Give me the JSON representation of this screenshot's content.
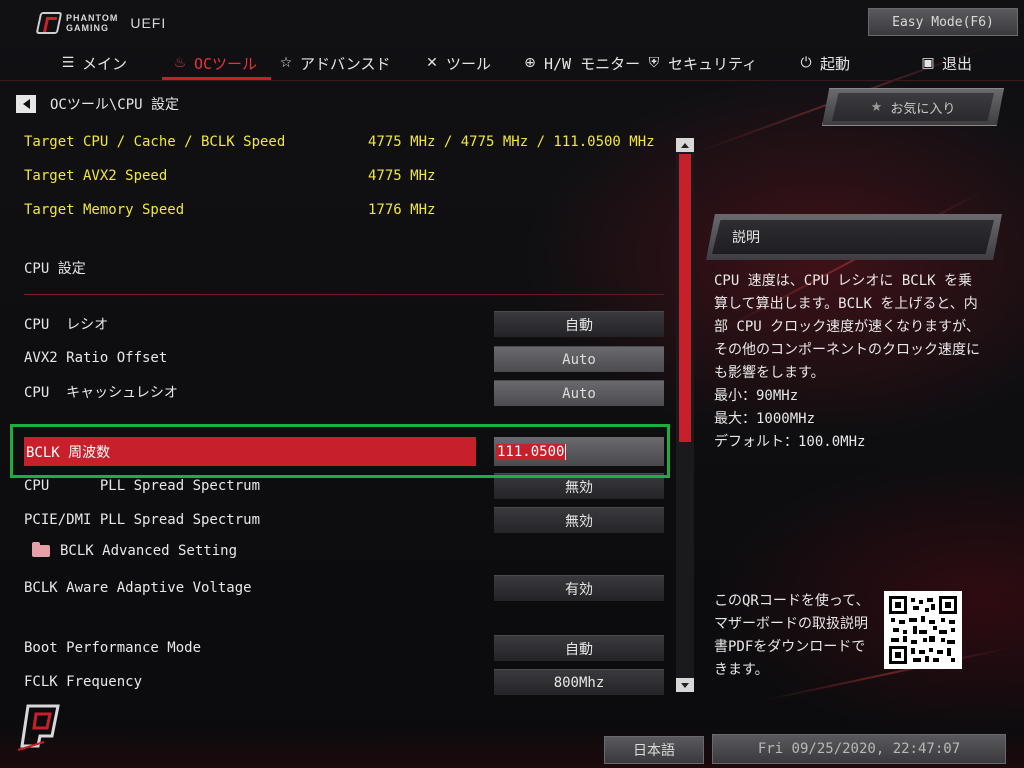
{
  "header": {
    "logo_line1": "PHANTOM",
    "logo_line2": "GAMING",
    "logo_uefi": "UEFI",
    "easy_mode_label": "Easy Mode(F6)"
  },
  "nav": {
    "items": [
      {
        "label": "メイン",
        "icon": "list-icon"
      },
      {
        "label": "OCツール",
        "icon": "flame-icon",
        "active": true
      },
      {
        "label": "アドバンスド",
        "icon": "star-icon"
      },
      {
        "label": "ツール",
        "icon": "tools-icon"
      },
      {
        "label": "H/W モニター",
        "icon": "crosshair-icon"
      },
      {
        "label": "セキュリティ",
        "icon": "shield-icon"
      },
      {
        "label": "起動",
        "icon": "power-icon"
      },
      {
        "label": "退出",
        "icon": "exit-icon"
      }
    ]
  },
  "breadcrumb": {
    "path": "OCツール\\CPU 設定"
  },
  "favorites": {
    "label": "お気に入り"
  },
  "targets": [
    {
      "label": "Target CPU / Cache / BCLK Speed",
      "value": "4775 MHz / 4775 MHz / 111.0500 MHz"
    },
    {
      "label": "Target AVX2 Speed",
      "value": "4775 MHz"
    },
    {
      "label": "Target Memory Speed",
      "value": "1776 MHz"
    }
  ],
  "section_title": "CPU 設定",
  "settings": {
    "cpu_ratio": {
      "label": "CPU  レシオ",
      "value": "自動"
    },
    "avx2_offset": {
      "label": "AVX2 Ratio Offset",
      "value": "Auto"
    },
    "cache_ratio": {
      "label": "CPU  キャッシュレシオ",
      "value": "Auto"
    },
    "bclk_freq": {
      "label": "BCLK 周波数",
      "value": "111.0500"
    },
    "cpu_pll": {
      "label": "CPU      PLL Spread Spectrum",
      "value": "無効"
    },
    "pcie_pll": {
      "label": "PCIE/DMI PLL Spread Spectrum",
      "value": "無効"
    },
    "bclk_adv": {
      "label": "BCLK Advanced Setting"
    },
    "bclk_aware": {
      "label": "BCLK Aware Adaptive Voltage",
      "value": "有効"
    },
    "boot_perf": {
      "label": "Boot Performance Mode",
      "value": "自動"
    },
    "fclk": {
      "label": "FCLK Frequency",
      "value": "800Mhz"
    }
  },
  "description": {
    "title": "説明",
    "text": "CPU 速度は、CPU レシオに BCLK を乗算して算出します。BCLK を上げると、内部 CPU クロック速度が速くなりますが、その他のコンポーネントのクロック速度にも影響をします。",
    "min": "最小：90MHz",
    "max": "最大：1000MHz",
    "default": "デフォルト：100.0MHz"
  },
  "qr": {
    "text": "このQRコードを使って、マザーボードの取扱説明書PDFをダウンロードできます。"
  },
  "footer": {
    "language": "日本語",
    "datetime": "Fri 09/25/2020, 22:47:07"
  },
  "colors": {
    "accent": "#c8202a",
    "target_text": "#f2e63c",
    "highlight_border": "#1fae3c"
  }
}
